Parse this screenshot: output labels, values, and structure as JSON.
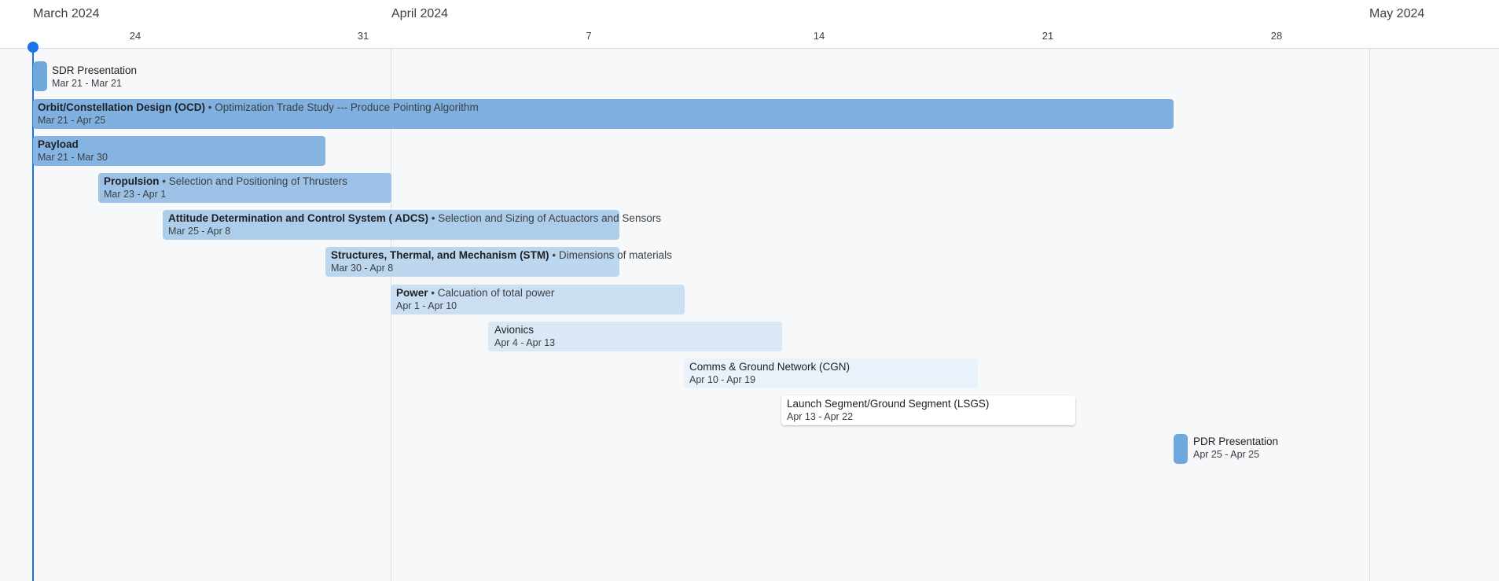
{
  "header": {
    "months": [
      {
        "label": "March 2024"
      },
      {
        "label": "April 2024"
      },
      {
        "label": "May 2024"
      }
    ],
    "weeks": [
      {
        "label": "24"
      },
      {
        "label": "31"
      },
      {
        "label": "7"
      },
      {
        "label": "14"
      },
      {
        "label": "21"
      },
      {
        "label": "28"
      }
    ]
  },
  "colors": {
    "today_marker": "#1a73e8",
    "bar_strong": "#7fb0e0",
    "bar_light": "#ffffff"
  },
  "tasks": [
    {
      "name": "SDR Presentation",
      "separator": "",
      "description": "",
      "dates": "Mar 21 - Mar 21",
      "milestone": true
    },
    {
      "name": "Orbit/Constellation Design (OCD)",
      "separator": "•",
      "description": "Optimization Trade Study --- Produce Pointing Algorithm",
      "dates": "Mar 21 - Apr 25"
    },
    {
      "name": "Payload",
      "separator": "",
      "description": "",
      "dates": "Mar 21 - Mar 30"
    },
    {
      "name": "Propulsion",
      "separator": "•",
      "description": "Selection and Positioning of Thrusters",
      "dates": "Mar 23 - Apr 1"
    },
    {
      "name": "Attitude Determination and Control System ( ADCS)",
      "separator": "•",
      "description": "Selection and Sizing of Actuactors and Sensors",
      "dates": "Mar 25 - Apr 8"
    },
    {
      "name": "Structures, Thermal, and Mechanism (STM)",
      "separator": "•",
      "description": "Dimensions of materials",
      "dates": "Mar 30 - Apr 8"
    },
    {
      "name": "Power",
      "separator": "•",
      "description": "Calcuation of total power",
      "dates": "Apr 1 - Apr 10"
    },
    {
      "name": "Avionics",
      "separator": "",
      "description": "",
      "dates": "Apr 4 - Apr 13"
    },
    {
      "name": "Comms & Ground Network (CGN)",
      "separator": "",
      "description": "",
      "dates": "Apr 10 - Apr 19"
    },
    {
      "name": "Launch Segment/Ground Segment (LSGS)",
      "separator": "",
      "description": "",
      "dates": "Apr 13 - Apr 22"
    },
    {
      "name": "PDR Presentation",
      "separator": "",
      "description": "",
      "dates": "Apr 25 - Apr 25",
      "milestone": true
    }
  ]
}
